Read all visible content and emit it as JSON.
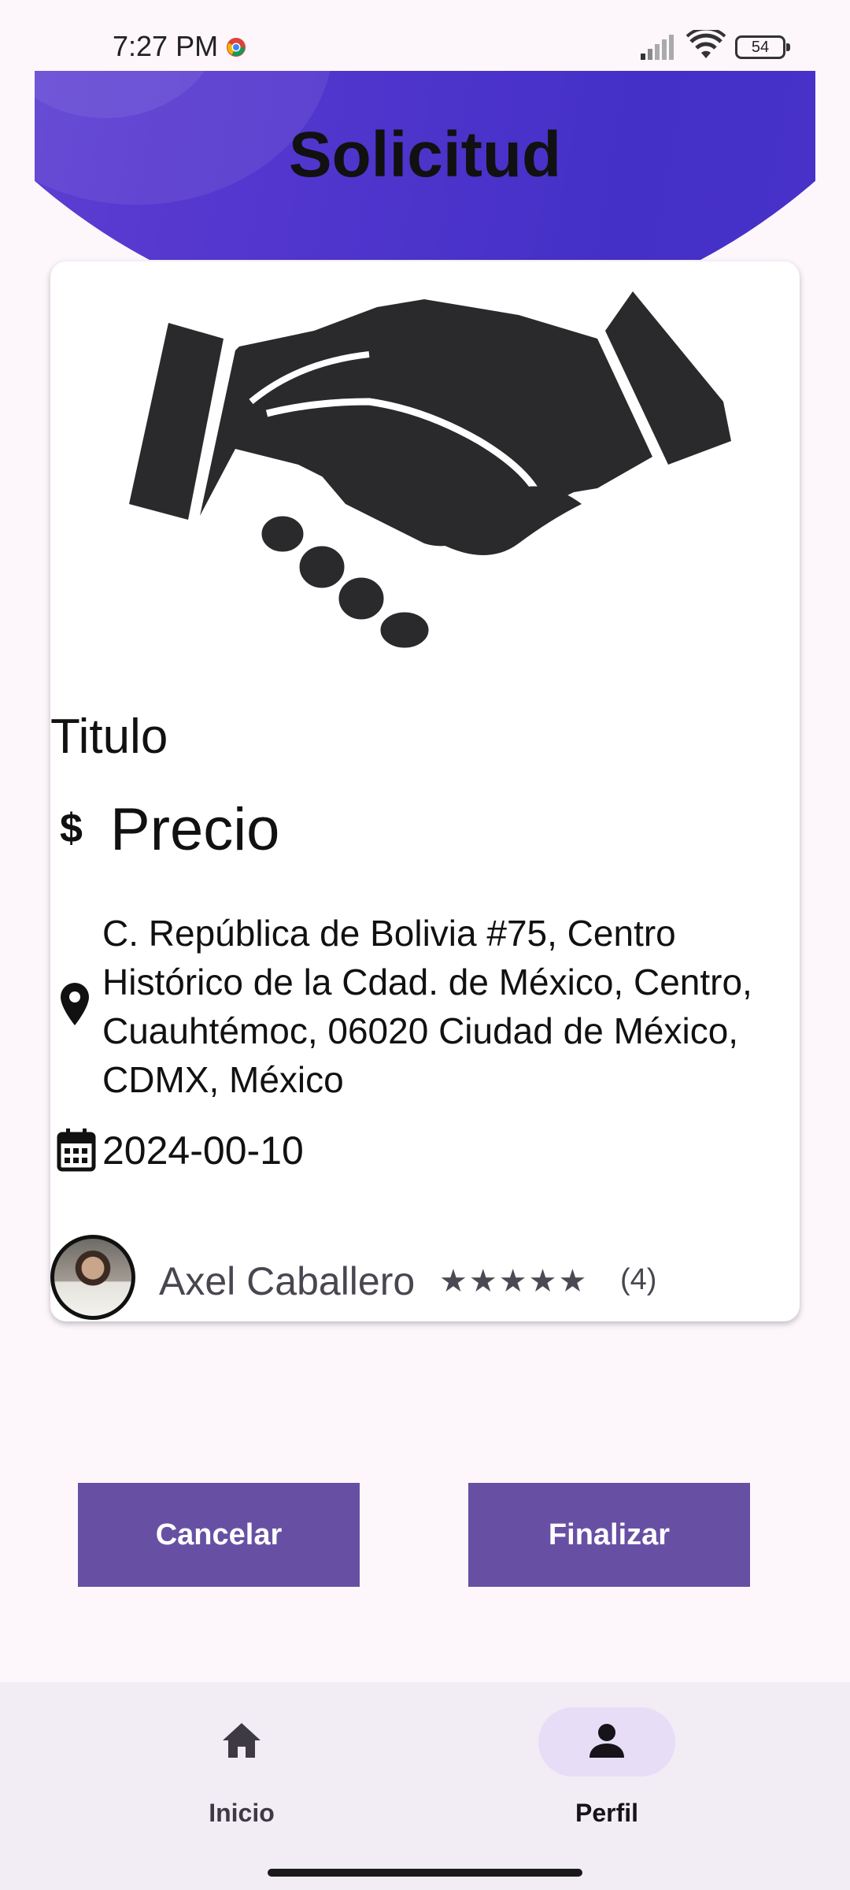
{
  "status_bar": {
    "time": "7:27 PM",
    "battery": "54"
  },
  "header": {
    "title": "Solicitud"
  },
  "card": {
    "image": "handshake-icon",
    "title": "Titulo",
    "price_icon": "$",
    "price": "Precio",
    "address": "C. República de Bolivia #75, Centro Histórico de la Cdad. de México, Centro, Cuauhtémoc, 06020 Ciudad de México, CDMX, México",
    "date": "2024-00-10",
    "user": {
      "name": "Axel Caballero",
      "rating_stars": 5,
      "rating_count": "(4)"
    }
  },
  "actions": {
    "cancel_label": "Cancelar",
    "finish_label": "Finalizar"
  },
  "bottom_nav": {
    "items": [
      {
        "label": "Inicio",
        "icon": "home-icon",
        "selected": false
      },
      {
        "label": "Perfil",
        "icon": "person-icon",
        "selected": true
      }
    ]
  },
  "colors": {
    "header_gradient": "#5638cf",
    "button": "#6750a4",
    "nav_selected_pill": "#e7ddf6",
    "background": "#fdf7fc"
  }
}
